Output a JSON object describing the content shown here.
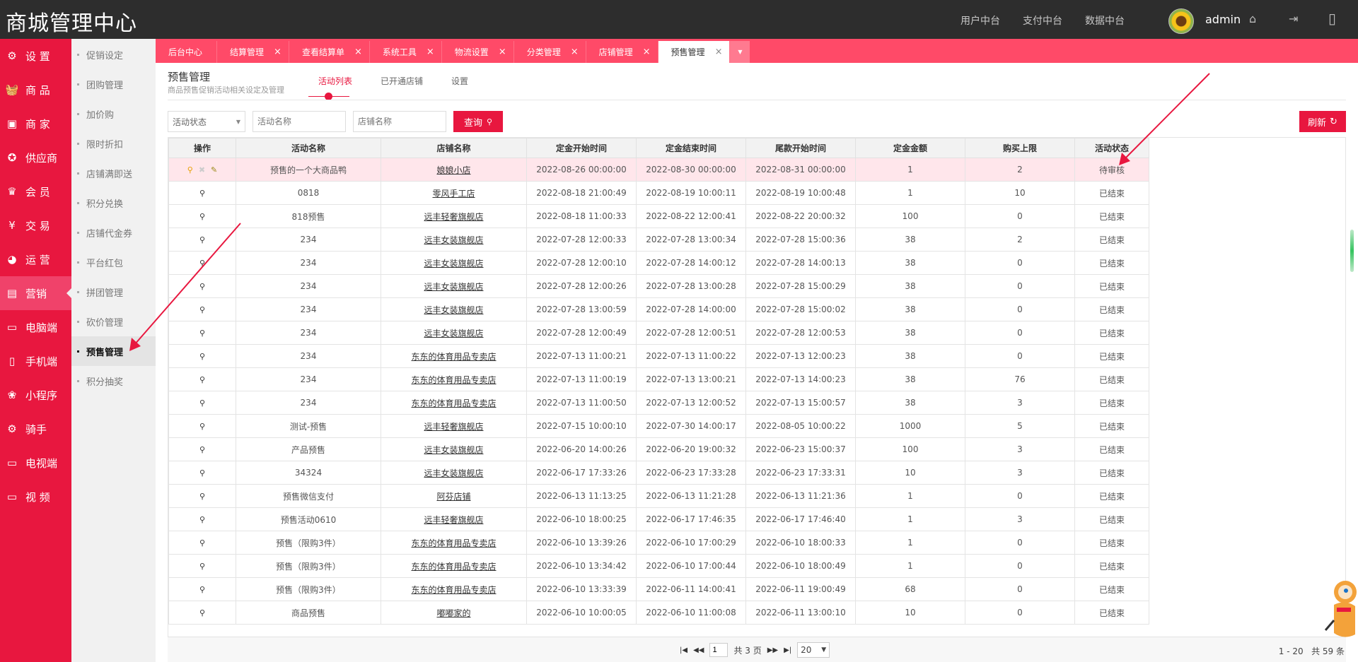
{
  "header": {
    "brand": "商城管理中心",
    "nav": [
      "用户中台",
      "支付中台",
      "数据中台"
    ],
    "admin": "admin"
  },
  "sidebar_main": [
    {
      "label": "设 置",
      "icon": "gear-icon",
      "glyph": "⚙"
    },
    {
      "label": "商 品",
      "icon": "basket-icon",
      "glyph": "🧺"
    },
    {
      "label": "商 家",
      "icon": "shop-icon",
      "glyph": "▣"
    },
    {
      "label": "供应商",
      "icon": "award-icon",
      "glyph": "✪"
    },
    {
      "label": "会 员",
      "icon": "crown-icon",
      "glyph": "♛"
    },
    {
      "label": "交 易",
      "icon": "yen-icon",
      "glyph": "¥"
    },
    {
      "label": "运 营",
      "icon": "pie-icon",
      "glyph": "◕"
    },
    {
      "label": "营销",
      "icon": "image-icon",
      "glyph": "▤"
    },
    {
      "label": "电脑端",
      "icon": "monitor-icon",
      "glyph": "▭"
    },
    {
      "label": "手机端",
      "icon": "phone-icon",
      "glyph": "▯"
    },
    {
      "label": "小程序",
      "icon": "miniprogram-icon",
      "glyph": "❀"
    },
    {
      "label": "骑手",
      "icon": "rider-icon",
      "glyph": "⚙"
    },
    {
      "label": "电视端",
      "icon": "tv-icon",
      "glyph": "▭"
    },
    {
      "label": "视 频",
      "icon": "video-icon",
      "glyph": "▭"
    }
  ],
  "sidebar_sub": [
    "促销设定",
    "团购管理",
    "加价购",
    "限时折扣",
    "店铺满即送",
    "积分兑换",
    "店铺代金券",
    "平台红包",
    "拼团管理",
    "砍价管理",
    "预售管理",
    "积分抽奖"
  ],
  "tabs": [
    "后台中心",
    "结算管理",
    "查看结算单",
    "系统工具",
    "物流设置",
    "分类管理",
    "店铺管理",
    "预售管理"
  ],
  "page": {
    "title": "预售管理",
    "subtitle": "商品预售促销活动相关设定及管理",
    "subtabs": [
      "活动列表",
      "已开通店铺",
      "设置"
    ]
  },
  "filters": {
    "status_select": "活动状态",
    "name_placeholder": "活动名称",
    "shop_placeholder": "店铺名称",
    "query": "查询",
    "refresh": "刷新"
  },
  "table": {
    "headers": [
      "操作",
      "活动名称",
      "店铺名称",
      "定金开始时间",
      "定金结束时间",
      "尾款开始时间",
      "定金金额",
      "购买上限",
      "活动状态"
    ],
    "rows": [
      [
        "预售的一个大商品鸭",
        "娘娘小店",
        "2022-08-26 00:00:00",
        "2022-08-30 00:00:00",
        "2022-08-31 00:00:00",
        "1",
        "2",
        "待审核"
      ],
      [
        "0818",
        "零风手工店",
        "2022-08-18 21:00:49",
        "2022-08-19 10:00:11",
        "2022-08-19 10:00:48",
        "1",
        "10",
        "已结束"
      ],
      [
        "818预售",
        "远丰轻奢旗舰店",
        "2022-08-18 11:00:33",
        "2022-08-22 12:00:41",
        "2022-08-22 20:00:32",
        "100",
        "0",
        "已结束"
      ],
      [
        "234",
        "远丰女装旗舰店",
        "2022-07-28 12:00:33",
        "2022-07-28 13:00:34",
        "2022-07-28 15:00:36",
        "38",
        "2",
        "已结束"
      ],
      [
        "234",
        "远丰女装旗舰店",
        "2022-07-28 12:00:10",
        "2022-07-28 14:00:12",
        "2022-07-28 14:00:13",
        "38",
        "0",
        "已结束"
      ],
      [
        "234",
        "远丰女装旗舰店",
        "2022-07-28 12:00:26",
        "2022-07-28 13:00:28",
        "2022-07-28 15:00:29",
        "38",
        "0",
        "已结束"
      ],
      [
        "234",
        "远丰女装旗舰店",
        "2022-07-28 13:00:59",
        "2022-07-28 14:00:00",
        "2022-07-28 15:00:02",
        "38",
        "0",
        "已结束"
      ],
      [
        "234",
        "远丰女装旗舰店",
        "2022-07-28 12:00:49",
        "2022-07-28 12:00:51",
        "2022-07-28 12:00:53",
        "38",
        "0",
        "已结束"
      ],
      [
        "234",
        "东东的体育用品专卖店",
        "2022-07-13 11:00:21",
        "2022-07-13 11:00:22",
        "2022-07-13 12:00:23",
        "38",
        "0",
        "已结束"
      ],
      [
        "234",
        "东东的体育用品专卖店",
        "2022-07-13 11:00:19",
        "2022-07-13 13:00:21",
        "2022-07-13 14:00:23",
        "38",
        "76",
        "已结束"
      ],
      [
        "234",
        "东东的体育用品专卖店",
        "2022-07-13 11:00:50",
        "2022-07-13 12:00:52",
        "2022-07-13 15:00:57",
        "38",
        "3",
        "已结束"
      ],
      [
        "测试-预售",
        "远丰轻奢旗舰店",
        "2022-07-15 10:00:10",
        "2022-07-30 14:00:17",
        "2022-08-05 10:00:22",
        "1000",
        "5",
        "已结束"
      ],
      [
        "产品预售",
        "远丰女装旗舰店",
        "2022-06-20 14:00:26",
        "2022-06-20 19:00:32",
        "2022-06-23 15:00:37",
        "100",
        "3",
        "已结束"
      ],
      [
        "34324",
        "远丰女装旗舰店",
        "2022-06-17 17:33:26",
        "2022-06-23 17:33:28",
        "2022-06-23 17:33:31",
        "10",
        "3",
        "已结束"
      ],
      [
        "预售微信支付",
        "阿芬店铺",
        "2022-06-13 11:13:25",
        "2022-06-13 11:21:28",
        "2022-06-13 11:21:36",
        "1",
        "0",
        "已结束"
      ],
      [
        "预售活动0610",
        "远丰轻奢旗舰店",
        "2022-06-10 18:00:25",
        "2022-06-17 17:46:35",
        "2022-06-17 17:46:40",
        "1",
        "3",
        "已结束"
      ],
      [
        "预售（限购3件）",
        "东东的体育用品专卖店",
        "2022-06-10 13:39:26",
        "2022-06-10 17:00:29",
        "2022-06-10 18:00:33",
        "1",
        "0",
        "已结束"
      ],
      [
        "预售（限购3件）",
        "东东的体育用品专卖店",
        "2022-06-10 13:34:42",
        "2022-06-10 17:00:44",
        "2022-06-10 18:00:49",
        "1",
        "0",
        "已结束"
      ],
      [
        "预售（限购3件）",
        "东东的体育用品专卖店",
        "2022-06-10 13:33:39",
        "2022-06-11 14:00:41",
        "2022-06-11 19:00:49",
        "68",
        "0",
        "已结束"
      ],
      [
        "商品预售",
        "嘟嘟家的",
        "2022-06-10 10:00:05",
        "2022-06-10 11:00:08",
        "2022-06-11 13:00:10",
        "10",
        "0",
        "已结束"
      ]
    ]
  },
  "pager": {
    "page": "1",
    "total_pages": "共 3 页",
    "page_size": "20",
    "range": "1 - 20",
    "total": "共 59 条"
  },
  "colors": {
    "primary": "#e8173f",
    "tab_bar": "#ff4a68",
    "top_bar": "#2d2d2d",
    "selected_row": "#ffe6eb"
  }
}
